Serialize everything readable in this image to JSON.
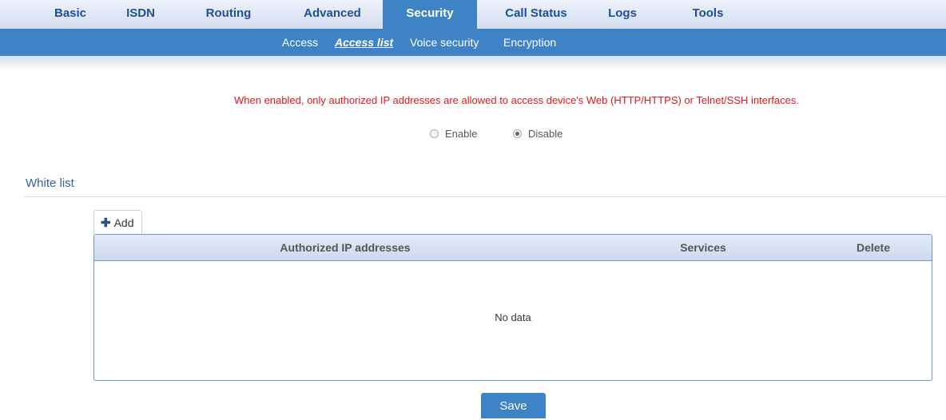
{
  "nav": {
    "tabs": [
      {
        "label": "Basic"
      },
      {
        "label": "ISDN"
      },
      {
        "label": "Routing"
      },
      {
        "label": "Advanced"
      },
      {
        "label": "Security",
        "active": true
      },
      {
        "label": "Call Status"
      },
      {
        "label": "Logs"
      },
      {
        "label": "Tools"
      }
    ]
  },
  "subnav": {
    "items": [
      {
        "label": "Access"
      },
      {
        "label": "Access list",
        "active": true
      },
      {
        "label": "Voice security"
      },
      {
        "label": "Encryption"
      }
    ]
  },
  "notice": "When enabled, only authorized IP addresses are allowed to access device's Web (HTTP/HTTPS) or Telnet/SSH interfaces.",
  "access_control": {
    "enable_label": "Enable",
    "disable_label": "Disable",
    "selected": "Disable"
  },
  "whitelist": {
    "title": "White list",
    "add_label": "Add",
    "columns": [
      "Authorized IP addresses",
      "Services",
      "Delete"
    ],
    "rows": [],
    "empty_text": "No data"
  },
  "save_label": "Save",
  "colors": {
    "accent": "#3f83c7",
    "notice": "#e0161c",
    "section_title": "#35619c"
  }
}
